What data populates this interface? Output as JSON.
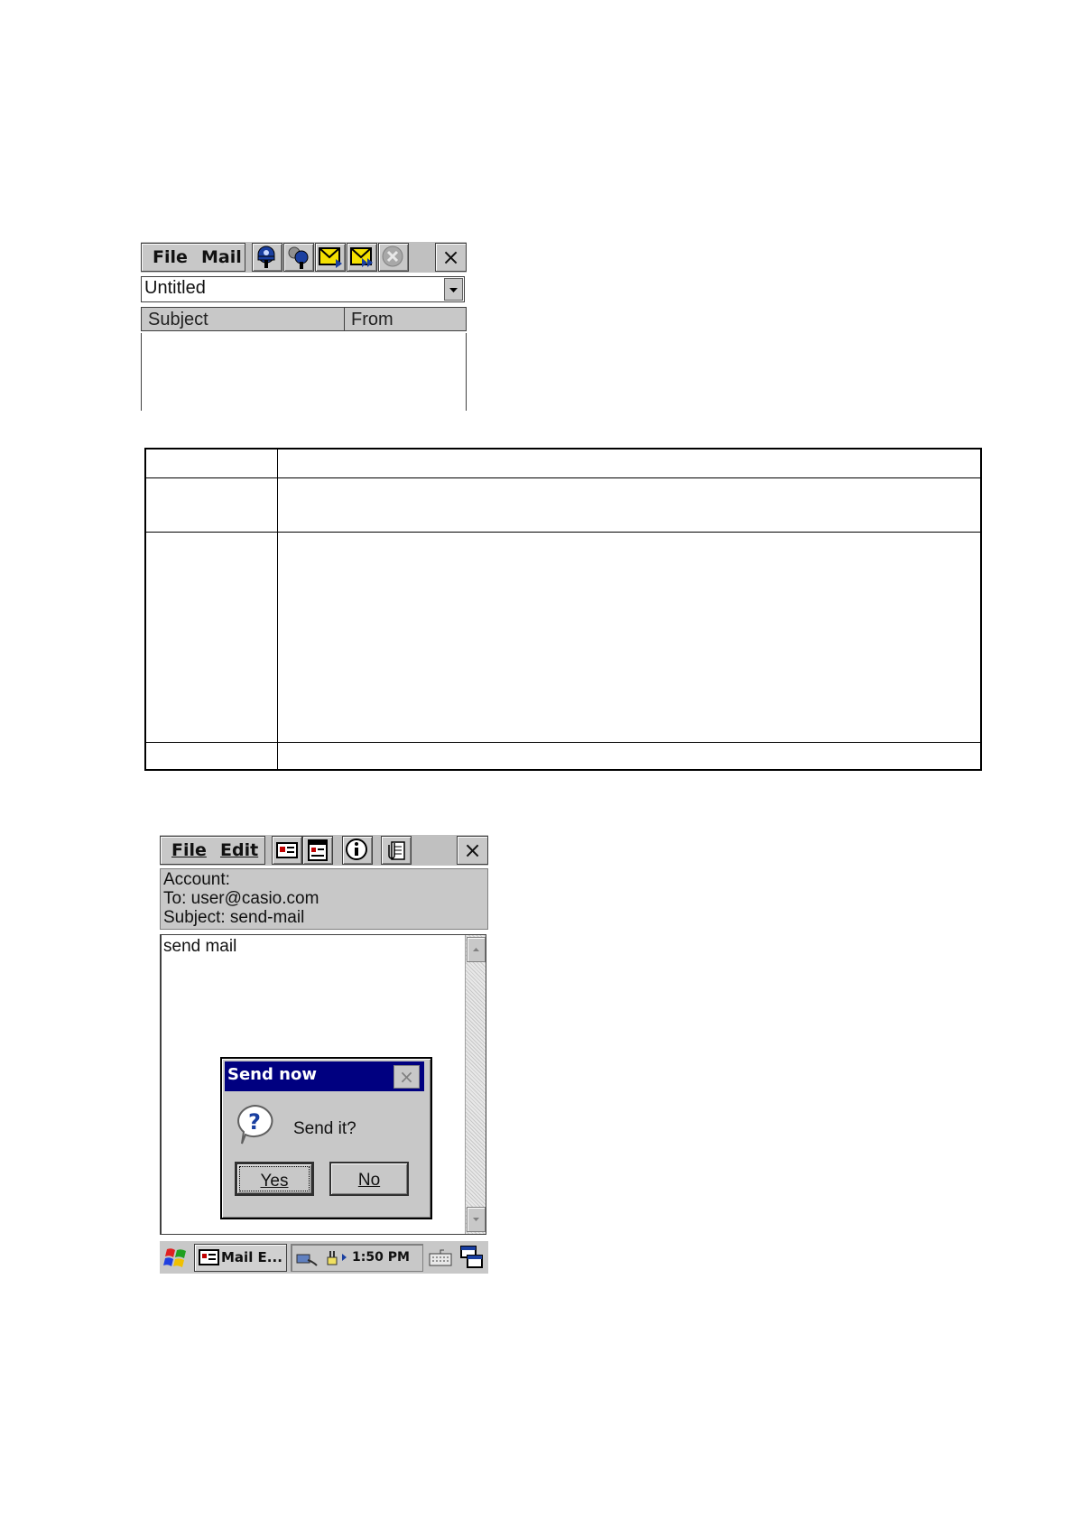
{
  "mail_list_window": {
    "menu": {
      "file": "File",
      "mail": "Mail"
    },
    "toolbar_icons": [
      "connect-icon",
      "disconnect-icon",
      "send-receive-icon",
      "send-receive-all-icon",
      "stop-icon"
    ],
    "close_label": "×",
    "folder_combo": {
      "value": "Untitled"
    },
    "columns": [
      "Subject",
      "From"
    ]
  },
  "compose_window": {
    "menu": {
      "file": "File",
      "edit": "Edit"
    },
    "toolbar_icons": [
      "address-card-icon",
      "form-icon",
      "info-icon",
      "attachment-icon"
    ],
    "close_label": "×",
    "header": {
      "account": "Account:",
      "to": "To: user@casio.com",
      "subject": "Subject: send-mail"
    },
    "body_text": "send mail",
    "dialog": {
      "title": "Send now",
      "close_label": "×",
      "message": "Send it?",
      "yes": "Yes",
      "no": "No"
    },
    "taskbar": {
      "task_label": "Mail E...",
      "clock": "1:50 PM"
    }
  }
}
